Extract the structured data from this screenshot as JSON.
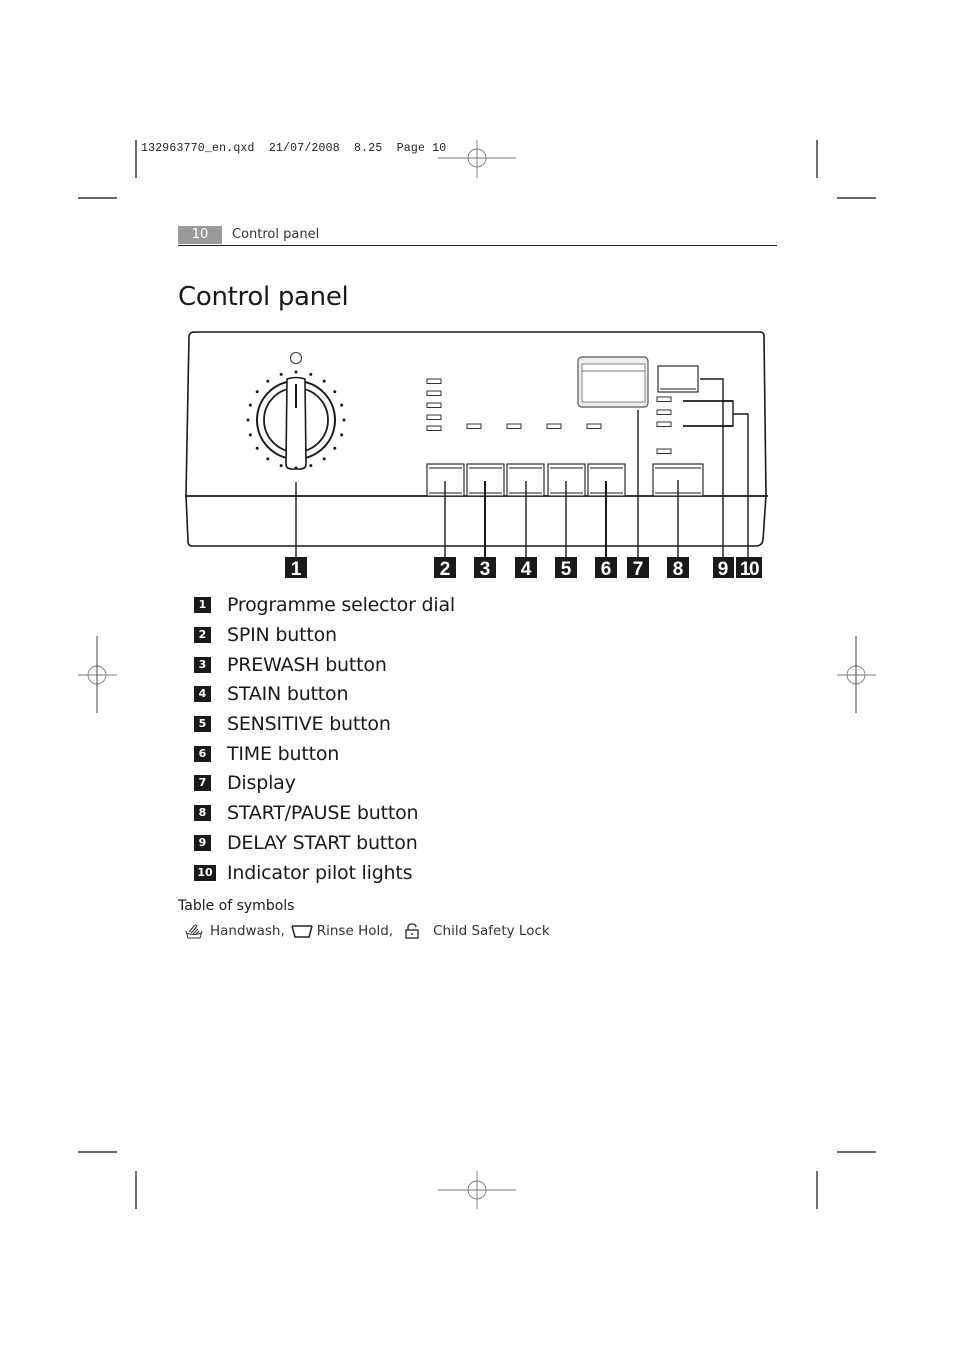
{
  "print_slug": {
    "filename": "132963770_en.qxd",
    "date": "21/07/2008",
    "time": "8.25",
    "page_label": "Page 10"
  },
  "running_header": {
    "page_number": "10",
    "section": "Control panel"
  },
  "page_title": "Control panel",
  "diagram": {
    "callouts": [
      "1",
      "2",
      "3",
      "4",
      "5",
      "6",
      "7",
      "8",
      "9",
      "10"
    ]
  },
  "legend": [
    {
      "num": "1",
      "label": "Programme selector dial"
    },
    {
      "num": "2",
      "label": "SPIN button"
    },
    {
      "num": "3",
      "label": "PREWASH button"
    },
    {
      "num": "4",
      "label": "STAIN button"
    },
    {
      "num": "5",
      "label": "SENSITIVE button"
    },
    {
      "num": "6",
      "label": "TIME button"
    },
    {
      "num": "7",
      "label": "Display"
    },
    {
      "num": "8",
      "label": "START/PAUSE button"
    },
    {
      "num": "9",
      "label": "DELAY START button"
    },
    {
      "num": "10",
      "label": "Indicator pilot lights"
    }
  ],
  "symbols": {
    "title": "Table of symbols",
    "items": [
      {
        "icon": "handwash-icon",
        "label": "Handwash,"
      },
      {
        "icon": "rinse-hold-icon",
        "label": "Rinse Hold,"
      },
      {
        "icon": "child-lock-icon",
        "label": "Child Safety Lock"
      }
    ]
  }
}
